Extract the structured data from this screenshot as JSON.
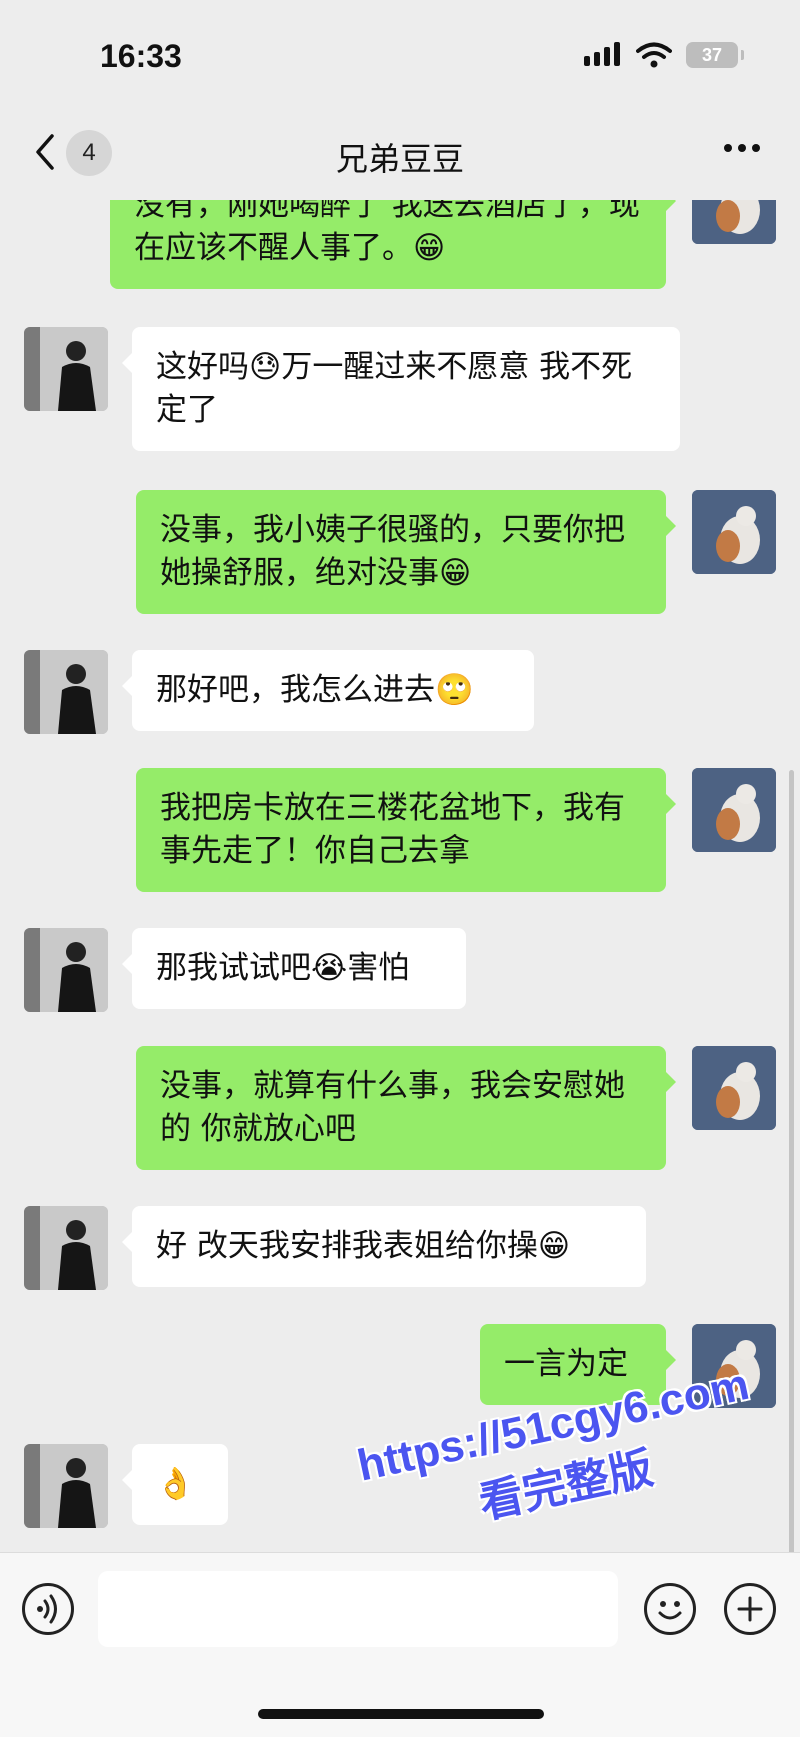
{
  "status_bar": {
    "time": "16:33",
    "battery": "37"
  },
  "nav": {
    "unread_count": "4",
    "title": "兄弟豆豆"
  },
  "messages": [
    {
      "side": "out",
      "text": "没有，刚她喝醉了 我送去酒店了，现在应该不醒人事了。😁"
    },
    {
      "side": "in",
      "text": "这好吗😓万一醒过来不愿意 我不死定了"
    },
    {
      "side": "out",
      "text": "没事，我小姨子很骚的，只要你把她操舒服，绝对没事😁"
    },
    {
      "side": "in",
      "text": "那好吧，我怎么进去🙄"
    },
    {
      "side": "out",
      "text": "我把房卡放在三楼花盆地下，我有事先走了！你自己去拿"
    },
    {
      "side": "in",
      "text": "那我试试吧😭害怕"
    },
    {
      "side": "out",
      "text": "没事，就算有什么事，我会安慰她的 你就放心吧"
    },
    {
      "side": "in",
      "text": "好 改天我安排我表姐给你操😁"
    },
    {
      "side": "out",
      "text": "一言为定"
    },
    {
      "side": "in",
      "text": "👌"
    }
  ],
  "watermark": {
    "url": "https://51cgy6.com",
    "text": "看完整版"
  },
  "icons": {
    "back": "chevron-left-icon",
    "more": "more-dots-icon",
    "voice": "voice-icon",
    "emoji": "emoji-icon",
    "plus": "plus-icon"
  },
  "colors": {
    "outgoing_bubble": "#95ec69",
    "incoming_bubble": "#ffffff",
    "background": "#ededed",
    "watermark": "#4b55f0"
  }
}
